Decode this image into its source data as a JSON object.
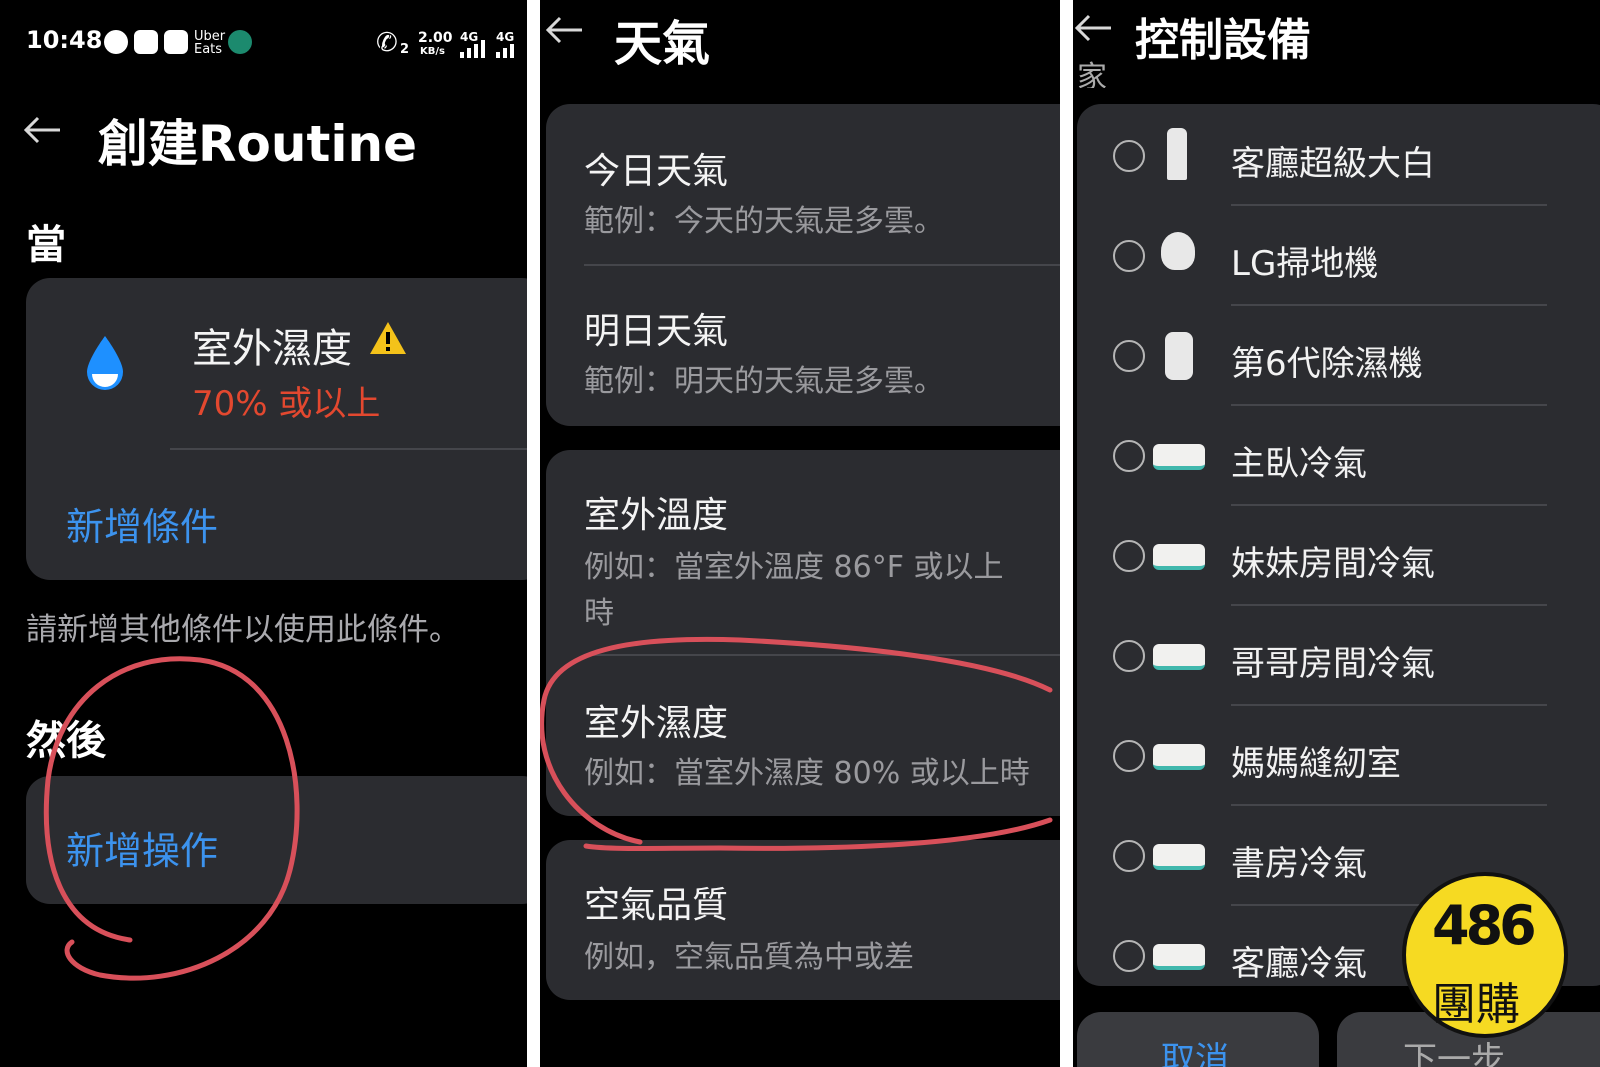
{
  "status_bar": {
    "time": "10:48",
    "app_icons": [
      "messenger-icon",
      "heart-app-icon",
      "payme-icon",
      "ubereats-icon",
      "green-app-icon"
    ],
    "ubereats_label": "Uber Eats",
    "call_label": "2",
    "speed": "2.00",
    "speed_unit": "KB/s",
    "net1": "4G",
    "net2": "4G"
  },
  "create_routine": {
    "back_icon": "arrow-left-icon",
    "title": "創建Routine",
    "when_label": "當",
    "condition": {
      "icon": "water-drop-icon",
      "name": "室外濕度",
      "warning_icon": "warning-icon",
      "value": "70% 或以上"
    },
    "add_condition": "新增條件",
    "hint": "請新增其他條件以使用此條件。",
    "then_label": "然後",
    "add_action": "新增操作"
  },
  "weather": {
    "back_icon": "arrow-left-icon",
    "title": "天氣",
    "items": [
      {
        "title": "今日天氣",
        "desc": "範例：今天的天氣是多雲。"
      },
      {
        "title": "明日天氣",
        "desc": "範例：明天的天氣是多雲。"
      },
      {
        "title": "室外溫度",
        "desc": "例如：當室外溫度 86°F 或以上",
        "desc2": "時"
      },
      {
        "title": "室外濕度",
        "desc": "例如：當室外濕度 80% 或以上時"
      },
      {
        "title": "空氣品質",
        "desc": "例如，空氣品質為中或差"
      }
    ]
  },
  "control_devices": {
    "back_icon": "arrow-left-icon",
    "title": "控制設備",
    "group_partial": "家",
    "devices": [
      {
        "name": "客廳超級大白",
        "icon": "air-purifier-icon"
      },
      {
        "name": "LG掃地機",
        "icon": "robot-vacuum-icon"
      },
      {
        "name": "第6代除濕機",
        "icon": "dehumidifier-icon"
      },
      {
        "name": "主臥冷氣",
        "icon": "air-conditioner-icon"
      },
      {
        "name": "妹妹房間冷氣",
        "icon": "air-conditioner-icon"
      },
      {
        "name": "哥哥房間冷氣",
        "icon": "air-conditioner-icon"
      },
      {
        "name": "媽媽縫紉室",
        "icon": "air-conditioner-icon"
      },
      {
        "name": "書房冷氣",
        "icon": "air-conditioner-icon"
      },
      {
        "name": "客廳冷氣",
        "icon": "air-conditioner-icon"
      }
    ],
    "cancel_partial": "取消",
    "next_partial": "下一步"
  },
  "watermark": {
    "logo_text": "486",
    "label": "團購"
  },
  "colors": {
    "accent_blue": "#3c93ee",
    "warning_red": "#e3482f",
    "card_bg": "#2b2c30",
    "annotation": "#d8505a",
    "stamp_yellow": "#f6da22"
  }
}
